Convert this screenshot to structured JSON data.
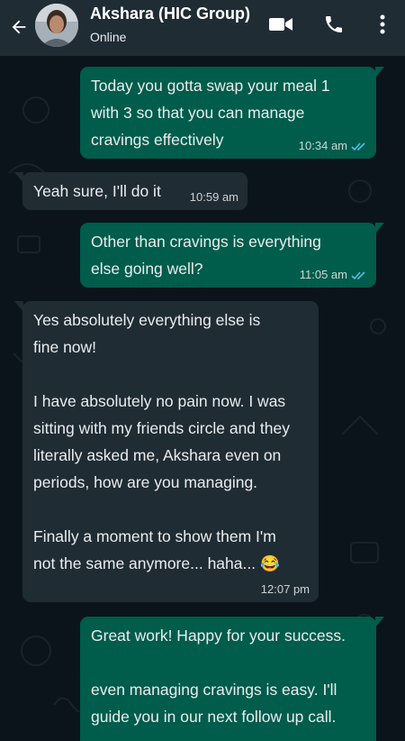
{
  "contact": {
    "name": "Akshara (HIC Group)",
    "status": "Online",
    "avatar_icon": "contact-avatar"
  },
  "header_icons": {
    "back": "arrow-left-icon",
    "video": "video-camera-icon",
    "call": "phone-icon",
    "menu": "more-vertical-icon"
  },
  "colors": {
    "header_bg": "#1f2c34",
    "chat_bg": "#0b141a",
    "outgoing_bubble": "#005c4b",
    "incoming_bubble": "#202c33",
    "read_tick": "#53bdeb"
  },
  "messages": [
    {
      "direction": "outgoing",
      "text": "Today you gotta swap your meal 1\nwith 3 so that you can manage\ncravings effectively",
      "time": "10:34 am",
      "read": true
    },
    {
      "direction": "incoming",
      "text": "Yeah sure, I'll do it",
      "time": "10:59 am"
    },
    {
      "direction": "outgoing",
      "text": "Other than cravings is everything\nelse going well?",
      "time": "11:05 am",
      "read": true
    },
    {
      "direction": "incoming",
      "text": " Yes absolutely everything else is\nfine now!\n\nI have absolutely no pain now. I was\nsitting with my friends circle and they\nliterally asked me, Akshara even on\nperiods, how are you managing.\n\nFinally a moment to show them I'm\nnot the same anymore... haha... 😂",
      "time": "12:07 pm"
    },
    {
      "direction": "outgoing",
      "text": "Great work! Happy for your success.\n\neven managing cravings is easy. I'll\nguide you in our next follow up call.",
      "time": ""
    }
  ]
}
